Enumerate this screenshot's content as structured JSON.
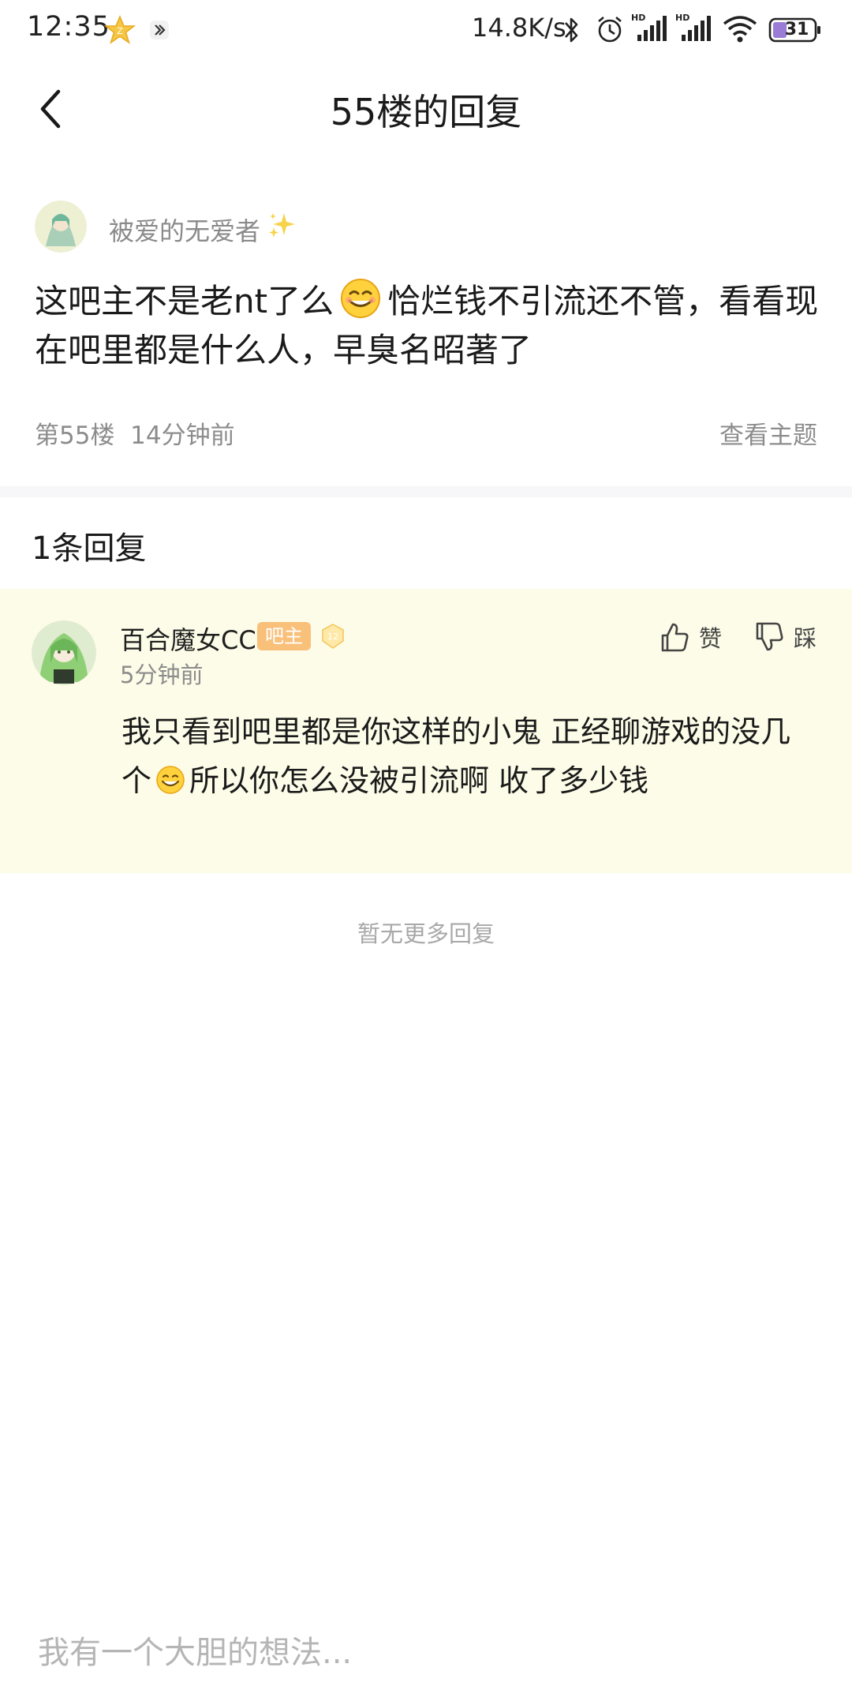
{
  "status_bar": {
    "time": "12:35",
    "net_speed": "14.8K/s",
    "battery": "31",
    "icons": [
      "star-icon",
      "app-icon",
      "bluetooth-icon",
      "alarm-icon",
      "signal-hd-icon",
      "signal-hd-icon",
      "wifi-icon",
      "battery-icon"
    ]
  },
  "header": {
    "title": "55楼的回复",
    "back_icon": "back-chevron-icon"
  },
  "post": {
    "author": "被爱的无爱者",
    "text_part1": "这吧主不是老nt了么",
    "text_part2": "恰烂钱不引流还不管，看看现在吧里都是什么人，早臭名昭著了",
    "floor": "第55楼",
    "time": "14分钟前",
    "view_topic": "查看主题"
  },
  "replies": {
    "count_label": "1条回复",
    "items": [
      {
        "author": "百合魔女CC",
        "badge": "吧主",
        "level": "12",
        "time": "5分钟前",
        "like_label": "赞",
        "dislike_label": "踩",
        "text_part1": "我只看到吧里都是你这样的小鬼 正经聊游戏的没几个",
        "text_part2": "所以你怎么没被引流啊 收了多少钱"
      }
    ],
    "no_more": "暂无更多回复"
  },
  "comment": {
    "placeholder": "我有一个大胆的想法..."
  },
  "colors": {
    "reply_bg": "#fdfce8",
    "badge": "#f9c07a",
    "muted_text": "#8c8c8c"
  }
}
